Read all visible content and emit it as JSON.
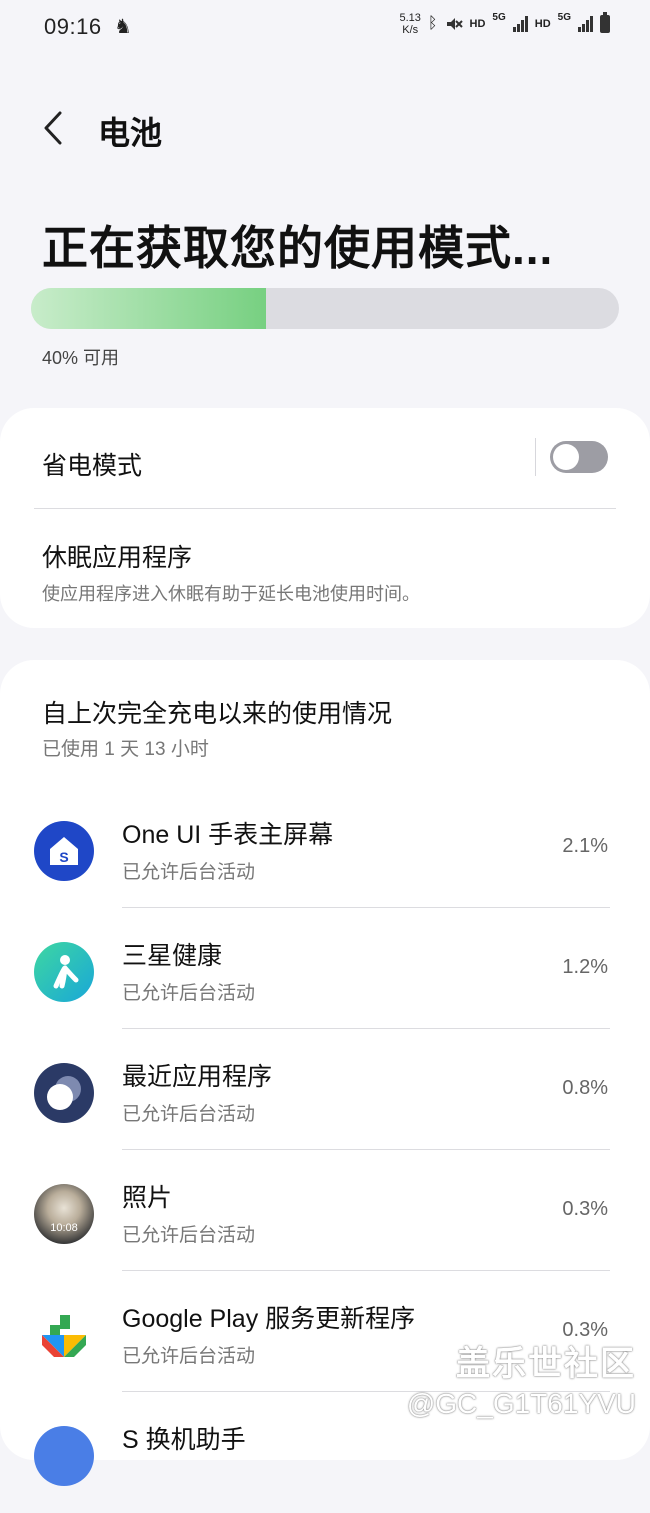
{
  "status_bar": {
    "time": "09:16",
    "net_speed_value": "5.13",
    "net_speed_unit": "K/s",
    "hd1": "HD",
    "g1": "5G",
    "hd2": "HD",
    "g2": "5G"
  },
  "header": {
    "title": "电池"
  },
  "battery": {
    "heading": "正在获取您的使用模式...",
    "level_percent": 40,
    "available_text": "40% 可用"
  },
  "power_saving": {
    "label": "省电模式",
    "enabled": false
  },
  "sleeping_apps": {
    "title": "休眠应用程序",
    "subtitle": "使应用程序进入休眠有助于延长电池使用时间。"
  },
  "usage": {
    "title": "自上次完全充电以来的使用情况",
    "subtitle": "已使用 1 天 13 小时",
    "apps": [
      {
        "name": "One UI 手表主屏幕",
        "status": "已允许后台活动",
        "percent": "2.1%",
        "icon": "one-ui-watch-home-icon"
      },
      {
        "name": "三星健康",
        "status": "已允许后台活动",
        "percent": "1.2%",
        "icon": "samsung-health-icon"
      },
      {
        "name": "最近应用程序",
        "status": "已允许后台活动",
        "percent": "0.8%",
        "icon": "recent-apps-icon"
      },
      {
        "name": "照片",
        "status": "已允许后台活动",
        "percent": "0.3%",
        "icon": "photos-icon",
        "icon_text": "10:08"
      },
      {
        "name": "Google Play 服务更新程序",
        "status": "已允许后台活动",
        "percent": "0.3%",
        "icon": "google-play-services-icon"
      },
      {
        "name": "S 换机助手",
        "status": "",
        "percent": "",
        "icon": "smart-switch-icon"
      }
    ]
  },
  "watermark": {
    "brand": "盖乐世社区",
    "user": "@GC_G1T61YVU"
  },
  "colors": {
    "accent_green": "#77d081",
    "toggle_off": "#9d9da4"
  }
}
